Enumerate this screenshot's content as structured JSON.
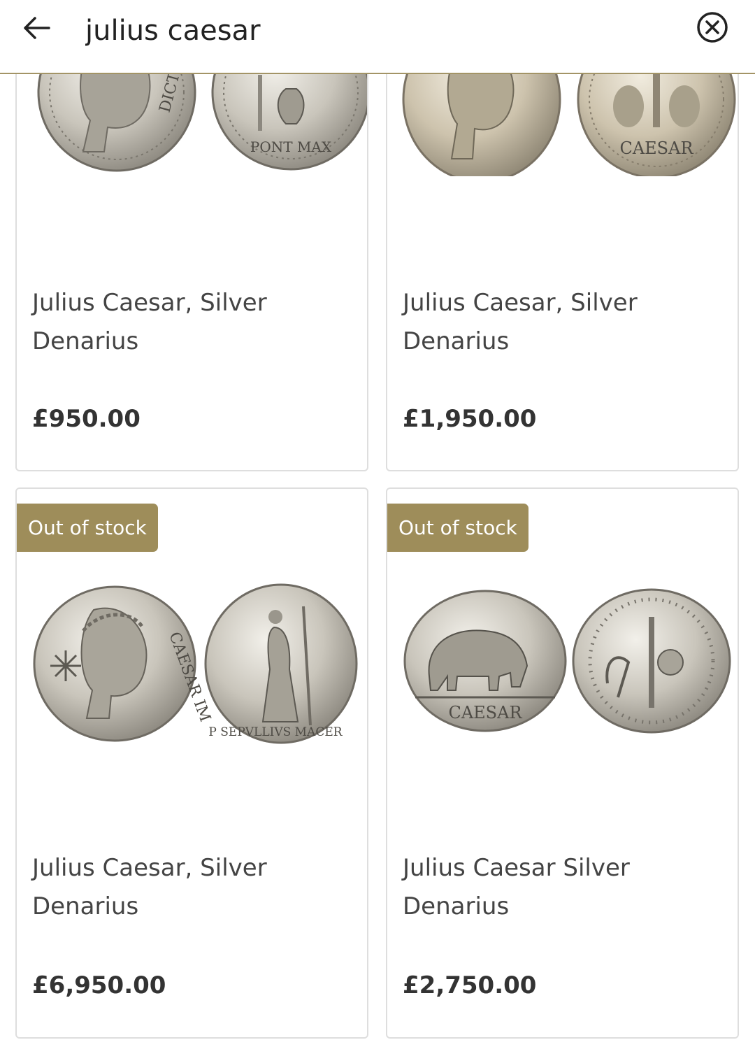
{
  "search": {
    "query": "julius caesar"
  },
  "products": [
    {
      "title": "Julius Caesar, Silver Denarius",
      "price": "£950.00",
      "badge": "",
      "obverse_legend": "DICT",
      "reverse_legend": "PONT MAX"
    },
    {
      "title": "Julius Caesar, Silver Denarius",
      "price": "£1,950.00",
      "badge": "",
      "obverse_legend": "",
      "reverse_legend": "CAESAR"
    },
    {
      "title": "Julius Caesar, Silver Denarius",
      "price": "£6,950.00",
      "badge": "Out of stock",
      "obverse_legend": "CAESAR IM",
      "reverse_legend": "P SEPVLLIVS MACER"
    },
    {
      "title": "Julius Caesar Silver Denarius",
      "price": "£2,750.00",
      "badge": "Out of stock",
      "obverse_legend": "CAESAR",
      "reverse_legend": ""
    }
  ],
  "colors": {
    "accent": "#9e8d5a",
    "divider": "#a39466",
    "card_border": "#dedede",
    "silver": "#c9c5bb"
  },
  "icons": {
    "back": "arrow-left-icon",
    "clear": "close-circle-icon"
  }
}
